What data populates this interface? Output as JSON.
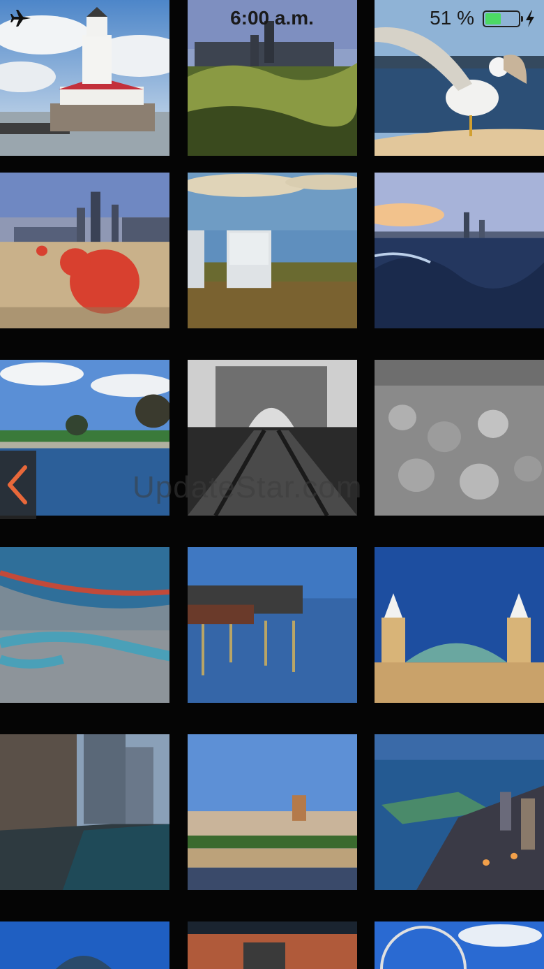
{
  "status_bar": {
    "time": "6:00 a.m.",
    "battery_percent": "51 %",
    "battery_level": 0.51,
    "icons": [
      "airplane-mode-icon",
      "battery-icon",
      "charging-icon"
    ]
  },
  "navigation": {
    "back_icon": "chevron-left-icon",
    "accent_color": "#e8683a"
  },
  "watermark": "UpdateStar.com",
  "gallery": {
    "photos": [
      {
        "subject": "lighthouse"
      },
      {
        "subject": "skyline-grass"
      },
      {
        "subject": "seagull"
      },
      {
        "subject": "beach-buoys"
      },
      {
        "subject": "adirondack-chairs"
      },
      {
        "subject": "skyline-water"
      },
      {
        "subject": "lakefront-park"
      },
      {
        "subject": "arch-railway"
      },
      {
        "subject": "rocks-bw"
      },
      {
        "subject": "boat-rope"
      },
      {
        "subject": "pier-night"
      },
      {
        "subject": "navy-pier-towers"
      },
      {
        "subject": "pier-walkway"
      },
      {
        "subject": "navy-pier-distance"
      },
      {
        "subject": "aerial-city"
      },
      {
        "subject": "dome"
      },
      {
        "subject": "scoreboard"
      },
      {
        "subject": "ferris-wheel"
      }
    ]
  }
}
